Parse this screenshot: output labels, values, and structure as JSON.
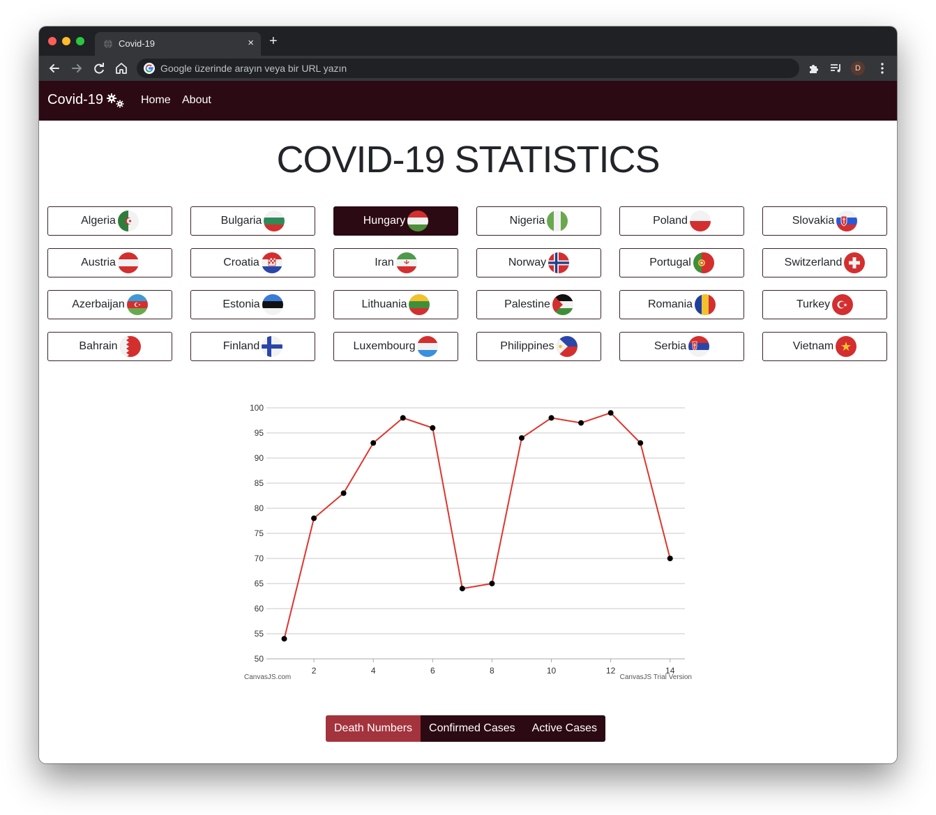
{
  "browser": {
    "tab_title": "Covid-19",
    "new_tab": "+",
    "tab_close": "×",
    "address_placeholder": "Google üzerinde arayın veya bir URL yazın",
    "profile_initial": "D"
  },
  "site": {
    "brand": "Covid-19",
    "nav": [
      "Home",
      "About"
    ],
    "title": "COVID-19 STATISTICS"
  },
  "countries": [
    {
      "name": "Algeria",
      "flag": "dz"
    },
    {
      "name": "Bulgaria",
      "flag": "bg"
    },
    {
      "name": "Hungary",
      "flag": "hu",
      "selected": true
    },
    {
      "name": "Nigeria",
      "flag": "ng"
    },
    {
      "name": "Poland",
      "flag": "pl"
    },
    {
      "name": "Slovakia",
      "flag": "sk"
    },
    {
      "name": "Austria",
      "flag": "at"
    },
    {
      "name": "Croatia",
      "flag": "hr"
    },
    {
      "name": "Iran",
      "flag": "ir"
    },
    {
      "name": "Norway",
      "flag": "no"
    },
    {
      "name": "Portugal",
      "flag": "pt"
    },
    {
      "name": "Switzerland",
      "flag": "ch"
    },
    {
      "name": "Azerbaijan",
      "flag": "az"
    },
    {
      "name": "Estonia",
      "flag": "ee"
    },
    {
      "name": "Lithuania",
      "flag": "lt"
    },
    {
      "name": "Palestine",
      "flag": "ps"
    },
    {
      "name": "Romania",
      "flag": "ro"
    },
    {
      "name": "Turkey",
      "flag": "tr"
    },
    {
      "name": "Bahrain",
      "flag": "bh"
    },
    {
      "name": "Finland",
      "flag": "fi"
    },
    {
      "name": "Luxembourg",
      "flag": "lu"
    },
    {
      "name": "Philippines",
      "flag": "ph"
    },
    {
      "name": "Serbia",
      "flag": "rs"
    },
    {
      "name": "Vietnam",
      "flag": "vn"
    }
  ],
  "chart_data": {
    "type": "line",
    "x": [
      1,
      2,
      3,
      4,
      5,
      6,
      7,
      8,
      9,
      10,
      11,
      12,
      13,
      14
    ],
    "series": [
      {
        "values": [
          54,
          78,
          83,
          93,
          98,
          96,
          64,
          65,
          94,
          98,
          97,
          99,
          93,
          70
        ],
        "color": "#e0342c"
      }
    ],
    "xlim": [
      0.4,
      14.5
    ],
    "ylim": [
      50,
      100
    ],
    "x_ticks": [
      2,
      4,
      6,
      8,
      10,
      12,
      14
    ],
    "y_ticks": [
      50,
      55,
      60,
      65,
      70,
      75,
      80,
      85,
      90,
      95,
      100
    ],
    "grid": "horizontal",
    "title": "",
    "xlabel": "",
    "ylabel": "",
    "credit_left": "CanvasJS.com",
    "credit_right": "CanvasJS Trial Version"
  },
  "stat_buttons": [
    {
      "label": "Death Numbers",
      "active": true
    },
    {
      "label": "Confirmed Cases",
      "active": false
    },
    {
      "label": "Active Cases",
      "active": false
    }
  ],
  "colors": {
    "navbar": "#2c0a13",
    "active_stat": "#a3333d",
    "line": "#e0342c"
  }
}
